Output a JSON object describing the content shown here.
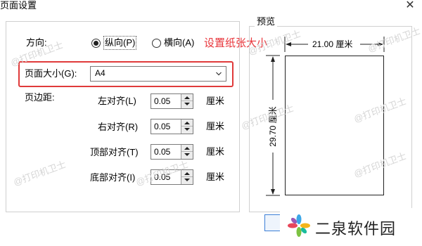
{
  "dialog": {
    "title": "页面设置",
    "close_glyph": "✕"
  },
  "orientation": {
    "label": "方向:",
    "portrait_label": "纵向(P)",
    "landscape_label": "横向(A)",
    "selected": "portrait"
  },
  "page_size": {
    "label": "页面大小(G):",
    "value": "A4"
  },
  "annotation": {
    "text": "设置纸张大小",
    "color": "#e8343a"
  },
  "margins": {
    "label": "页边距:",
    "unit": "厘米",
    "items": [
      {
        "label": "左对齐(L)",
        "value": "0.05"
      },
      {
        "label": "右对齐(R)",
        "value": "0.05"
      },
      {
        "label": "顶部对齐(T)",
        "value": "0.05"
      },
      {
        "label": "底部对齐(I)",
        "value": "0.05"
      }
    ]
  },
  "preview": {
    "title": "预览",
    "width_label": "21.00 厘米",
    "height_label": "29.70 厘米"
  },
  "watermark": {
    "text": "@打印机卫士"
  },
  "brand": {
    "name": "二泉软件园"
  }
}
